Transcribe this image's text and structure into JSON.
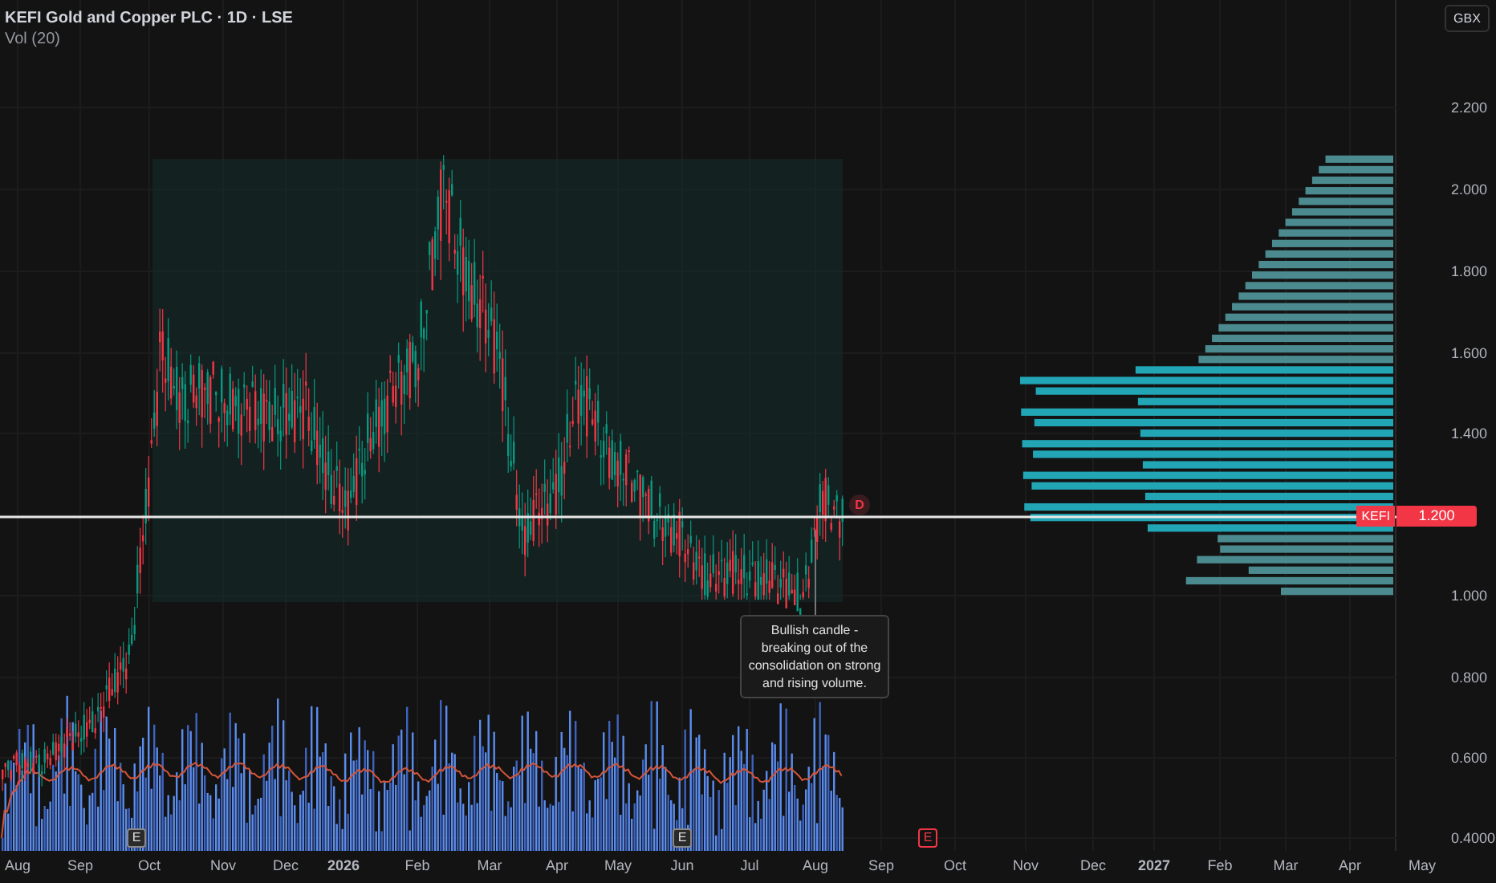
{
  "header": {
    "title": "KEFI Gold and Copper PLC · 1D · LSE",
    "indicator": "Vol (20)"
  },
  "currency_button": "GBX",
  "price_axis": [
    "2.200",
    "2.000",
    "1.800",
    "1.600",
    "1.400",
    "1.000",
    "0.800",
    "0.600",
    "0.4000"
  ],
  "last_price": {
    "symbol": "KEFI",
    "price": "1.200"
  },
  "time_axis": [
    "Aug",
    "Sep",
    "Oct",
    "Nov",
    "Dec",
    "2026",
    "Feb",
    "Mar",
    "Apr",
    "May",
    "Jun",
    "Jul",
    "Aug",
    "Sep",
    "Oct",
    "Nov",
    "Dec",
    "2027",
    "Feb",
    "Mar",
    "Apr",
    "May"
  ],
  "annotation": "Bullish candle - breaking out of the consolidation on strong and rising volume.",
  "dividend_marker": "D",
  "earnings_markers": [
    "E",
    "E",
    "E"
  ]
}
